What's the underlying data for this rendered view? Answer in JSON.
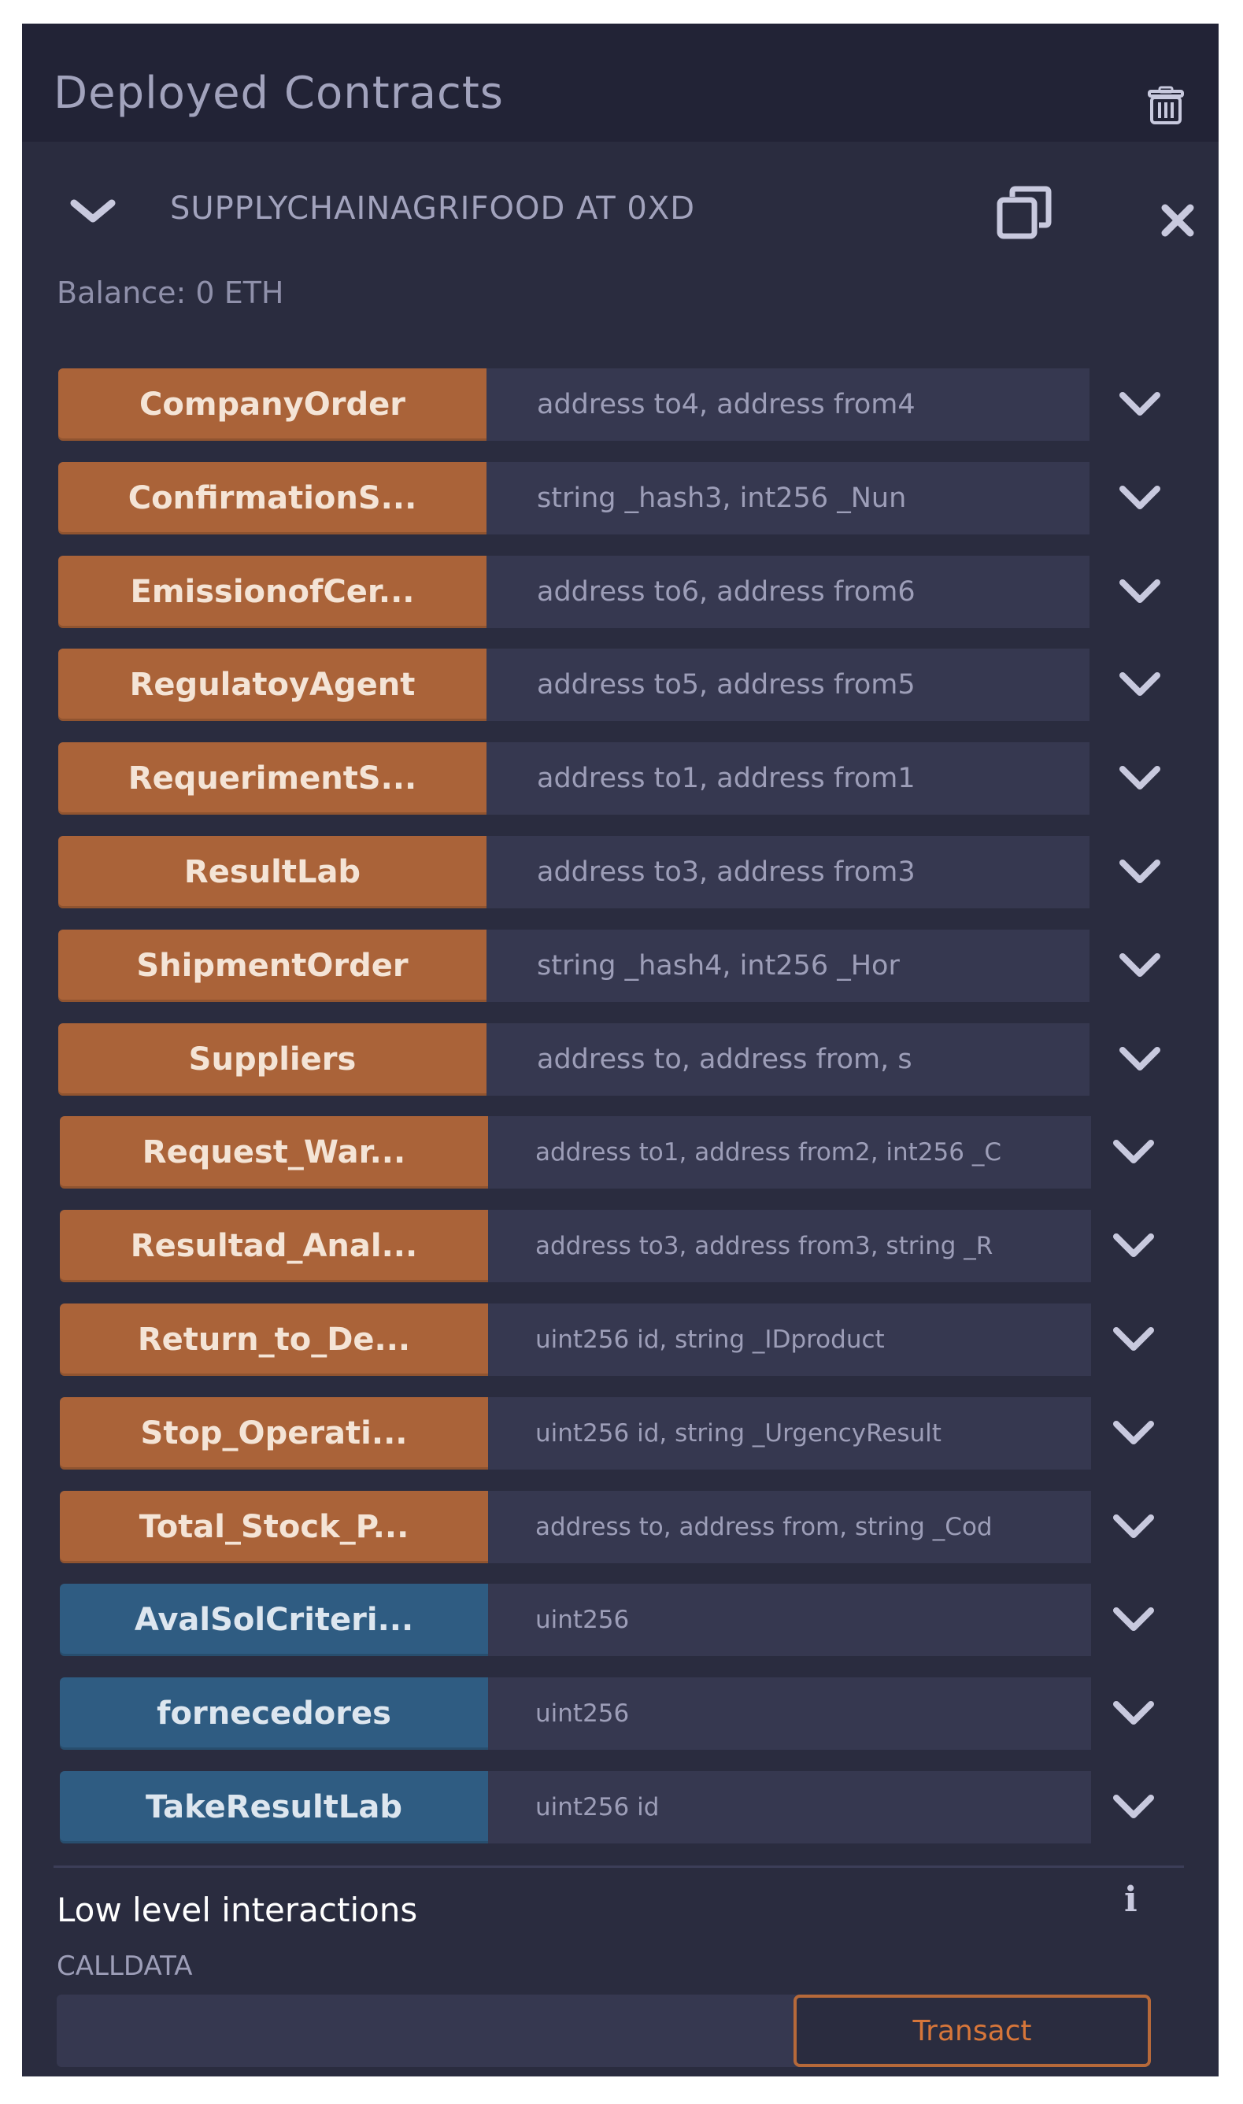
{
  "header": {
    "title": "Deployed Contracts",
    "trash_icon": "trash-icon"
  },
  "instance": {
    "name": "SUPPLYCHAINAGRIFOOD AT 0XD",
    "balance": "Balance: 0 ETH",
    "copy_icon": "copy-icon",
    "close_icon": "close-icon"
  },
  "functions": [
    {
      "label": "CompanyOrder",
      "params": "address to4, address from4",
      "type": "transact",
      "color": "#aa6339"
    },
    {
      "label": "ConfirmationS...",
      "params": "string _hash3, int256 _Nun",
      "type": "transact",
      "color": "#aa6339"
    },
    {
      "label": "EmissionofCer...",
      "params": "address to6, address from6",
      "type": "transact",
      "color": "#aa6339"
    },
    {
      "label": "RegulatoyAgent",
      "params": "address to5, address from5",
      "type": "transact",
      "color": "#aa6339"
    },
    {
      "label": "RequerimentS...",
      "params": "address to1, address from1",
      "type": "transact",
      "color": "#aa6339"
    },
    {
      "label": "ResultLab",
      "params": "address to3, address from3",
      "type": "transact",
      "color": "#aa6339"
    },
    {
      "label": "ShipmentOrder",
      "params": "string _hash4, int256 _Hor",
      "type": "transact",
      "color": "#aa6339"
    },
    {
      "label": "Suppliers",
      "params": "address to, address from, s",
      "type": "transact",
      "color": "#aa6339"
    },
    {
      "label": "Request_War...",
      "params": "address to1, address from2, int256 _C",
      "type": "transact",
      "color": "#aa6339"
    },
    {
      "label": "Resultad_Anal...",
      "params": "address to3, address from3, string _R",
      "type": "transact",
      "color": "#aa6339"
    },
    {
      "label": "Return_to_De...",
      "params": "uint256 id, string _IDproduct",
      "type": "transact",
      "color": "#aa6339"
    },
    {
      "label": "Stop_Operati...",
      "params": "uint256 id, string _UrgencyResult",
      "type": "transact",
      "color": "#aa6339"
    },
    {
      "label": "Total_Stock_P...",
      "params": "address to, address from, string _Cod",
      "type": "transact",
      "color": "#aa6339"
    },
    {
      "label": "AvalSolCriteri...",
      "params": "uint256",
      "type": "call",
      "color": "#2f5c82"
    },
    {
      "label": "fornecedores",
      "params": "uint256",
      "type": "call",
      "color": "#2f5c82"
    },
    {
      "label": "TakeResultLab",
      "params": "uint256 id",
      "type": "call",
      "color": "#2f5c82"
    }
  ],
  "low_level": {
    "title": "Low level interactions",
    "info_icon": "info-icon",
    "info_glyph": "i",
    "calldata_label": "CALLDATA",
    "calldata_value": "",
    "transact_label": "Transact"
  },
  "colors": {
    "panel_bg": "#2a2c3f",
    "transact_button": "#aa6339",
    "call_button": "#2f5c82",
    "accent": "#d7763a"
  }
}
